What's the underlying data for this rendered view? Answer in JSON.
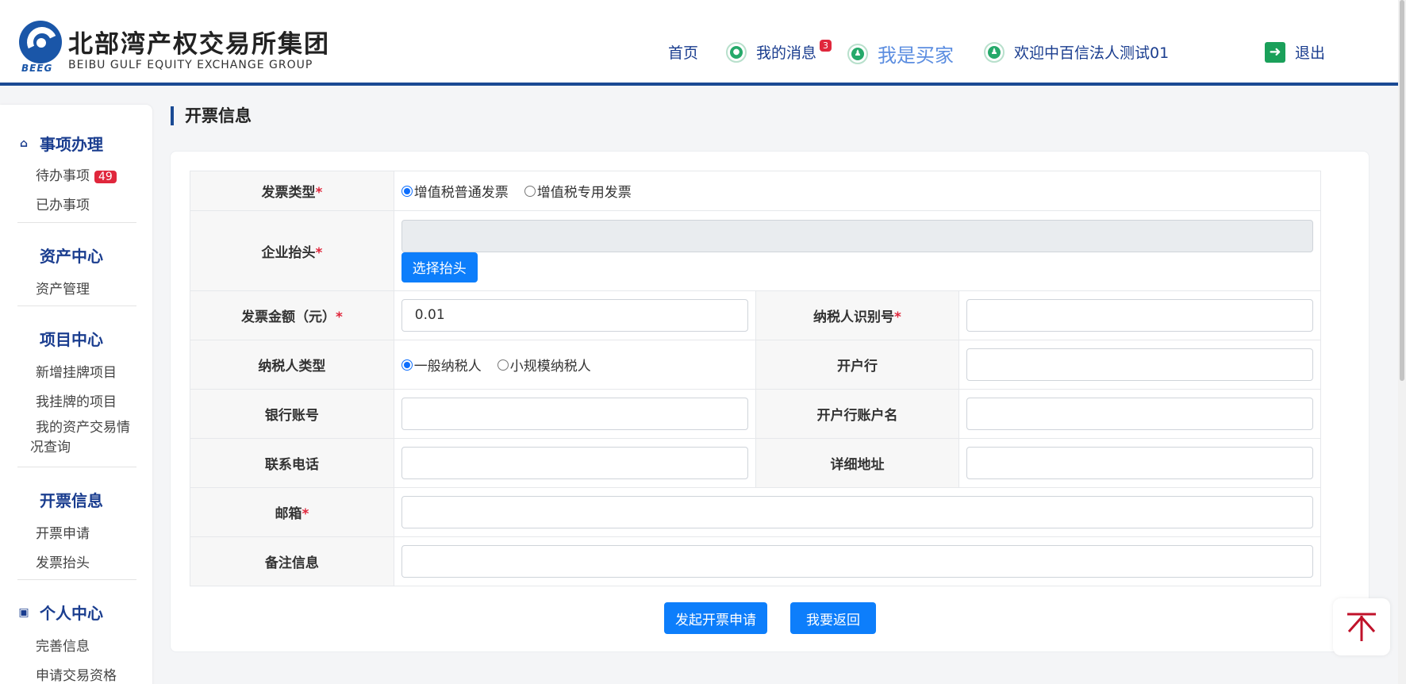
{
  "logo": {
    "abbr": "BEEG",
    "cn": "北部湾产权交易所集团",
    "en": "BEIBU GULF EQUITY EXCHANGE GROUP"
  },
  "nav": {
    "home": "首页",
    "messages": "我的消息",
    "messages_count": "3",
    "role": "我是买家",
    "welcome": "欢迎中百信法人测试01",
    "logout": "退出"
  },
  "sidebar": {
    "groups": [
      {
        "title": "事项办理",
        "icon": "home-icon",
        "items": [
          {
            "label": "待办事项",
            "badge": "49"
          },
          {
            "label": "已办事项"
          }
        ]
      },
      {
        "title": "资产中心",
        "icon": "grid-icon",
        "items": [
          {
            "label": "资产管理"
          }
        ]
      },
      {
        "title": "项目中心",
        "icon": "grid-icon",
        "items": [
          {
            "label": "新增挂牌项目"
          },
          {
            "label": "我挂牌的项目"
          },
          {
            "label": "我的资产交易情况查询"
          }
        ]
      },
      {
        "title": "开票信息",
        "icon": "grid-icon",
        "items": [
          {
            "label": "开票申请"
          },
          {
            "label": "发票抬头"
          }
        ]
      },
      {
        "title": "个人中心",
        "icon": "contact-book-icon",
        "items": [
          {
            "label": "完善信息"
          },
          {
            "label": "申请交易资格"
          }
        ]
      }
    ]
  },
  "page": {
    "title": "开票信息"
  },
  "form": {
    "invoice_type": {
      "label": "发票类型",
      "required": "*",
      "options": [
        "增值税普通发票",
        "增值税专用发票"
      ],
      "selected": "增值税普通发票"
    },
    "company_title": {
      "label": "企业抬头",
      "required": "*",
      "value": "",
      "choose_button": "选择抬头"
    },
    "amount": {
      "label": "发票金额（元）",
      "required": "*",
      "value": "0.01"
    },
    "taxpayer_id": {
      "label": "纳税人识别号",
      "required": "*",
      "value": ""
    },
    "taxpayer_type": {
      "label": "纳税人类型",
      "options": [
        "一般纳税人",
        "小规模纳税人"
      ],
      "selected": "一般纳税人"
    },
    "bank": {
      "label": "开户行",
      "value": ""
    },
    "bank_account": {
      "label": "银行账号",
      "value": ""
    },
    "account_name": {
      "label": "开户行账户名",
      "value": ""
    },
    "phone": {
      "label": "联系电话",
      "value": ""
    },
    "address": {
      "label": "详细地址",
      "value": ""
    },
    "email": {
      "label": "邮箱",
      "required": "*",
      "value": ""
    },
    "remark": {
      "label": "备注信息",
      "value": ""
    }
  },
  "actions": {
    "submit": "发起开票申请",
    "back": "我要返回"
  },
  "colors": {
    "primary_button": "#0d7efb",
    "brand_navy": "#1a3d8f",
    "required": "#e0273c",
    "back_to_top": "#c0122a"
  }
}
